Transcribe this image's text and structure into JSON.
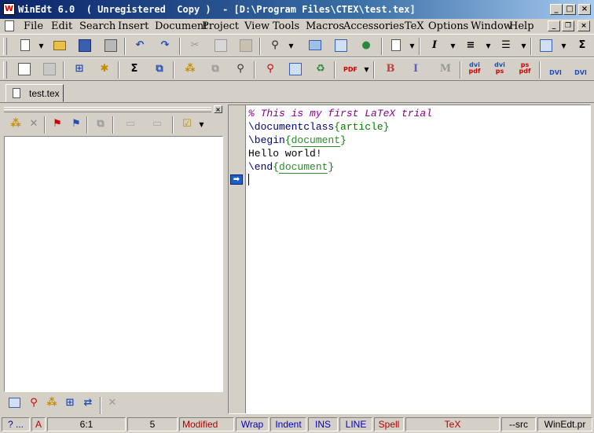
{
  "window": {
    "title": "WinEdt 6.0  ( Unregistered  Copy )  - [D:\\Program Files\\CTEX\\test.tex]",
    "icon_letter": "W",
    "minimize_glyph": "_",
    "maximize_glyph": "□",
    "close_glyph": "×"
  },
  "menu": {
    "items": [
      "File",
      "Edit",
      "Search",
      "Insert",
      "Document",
      "Project",
      "View",
      "Tools",
      "Macros",
      "Accessories",
      "TeX",
      "Options",
      "Window",
      "Help"
    ],
    "mdi_minimize": "_",
    "mdi_restore": "❐",
    "mdi_close": "×"
  },
  "toolbar1": {
    "icons": [
      "new-document-icon",
      "open-folder-icon",
      "save-icon",
      "print-icon",
      "undo-icon",
      "redo-icon",
      "cut-icon",
      "copy-icon",
      "paste-icon",
      "find-icon",
      "replace-icon",
      "table-icon",
      "globe-icon",
      "document-properties-icon",
      "italic-icon",
      "align-icon",
      "list-icon",
      "grid-table-icon",
      "sum-icon"
    ],
    "italic": "I",
    "sum": "Σ"
  },
  "toolbar2": {
    "labels": {
      "sigma": "Σ",
      "pdf": "PDF",
      "bold": "B",
      "italic": "I",
      "mono": "M",
      "dvi_pdf_top": "dvi",
      "dvi_pdf_bottom": "pdf",
      "dvi_ps_top": "dvi",
      "dvi_ps_bottom": "ps",
      "ps_pdf_top": "ps",
      "ps_pdf_bottom": "pdf",
      "dvi_view": "DVI",
      "dvi_search": "DVI"
    }
  },
  "tabs": [
    {
      "label": "test.tex"
    }
  ],
  "pane": {
    "close_glyph": "×"
  },
  "editor": {
    "lines": [
      {
        "comment": "% This is my first LaTeX trial"
      },
      {
        "cmd": "\\documentclass",
        "open": "{",
        "arg": "article",
        "close": "}"
      },
      {
        "cmd": "\\begin",
        "open": "{",
        "arg": "document",
        "close": "}"
      },
      {
        "text": "Hello world!"
      },
      {
        "cmd": "\\end",
        "open": "{",
        "arg": "document",
        "close": "}"
      }
    ],
    "bookmark_glyph": "➡"
  },
  "status": {
    "help": "? ...",
    "mode": "A",
    "position": "6:1",
    "lines": "5",
    "modified": "Modified",
    "wrap": "Wrap",
    "indent": "Indent",
    "ins": "INS",
    "line": "LINE",
    "spell": "Spell",
    "tex": "TeX",
    "src": "--src",
    "app": "WinEdt.pr"
  },
  "colors": {
    "title_gradient_start": "#0a246a",
    "comment": "#8b008b",
    "brace": "#008000",
    "argument": "#2e8b2e",
    "status_red": "#b00000",
    "status_blue": "#0000c0"
  }
}
